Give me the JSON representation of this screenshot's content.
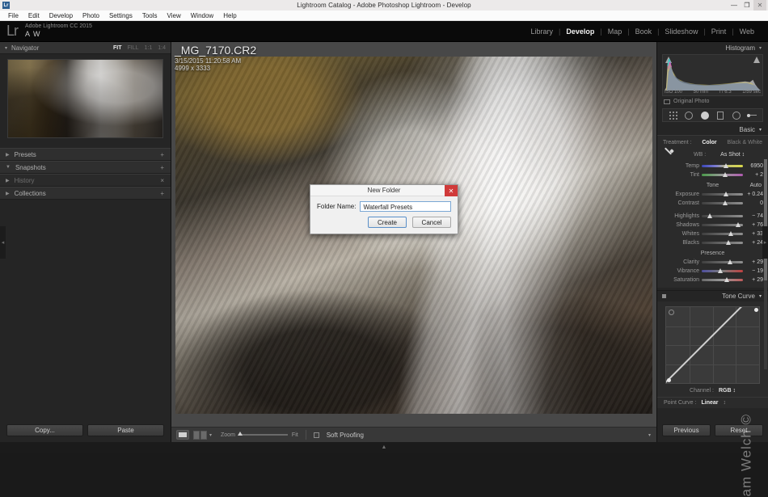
{
  "window": {
    "title": "Lightroom Catalog - Adobe Photoshop Lightroom - Develop",
    "minimize": "—",
    "maximize": "❐",
    "close": "✕",
    "app_icon_text": "Lr"
  },
  "menubar": [
    "File",
    "Edit",
    "Develop",
    "Photo",
    "Settings",
    "Tools",
    "View",
    "Window",
    "Help"
  ],
  "identity": {
    "logo": "Lr",
    "line1": "Adobe Lightroom CC 2015",
    "line2": "A W"
  },
  "modules": [
    {
      "label": "Library",
      "active": false
    },
    {
      "label": "Develop",
      "active": true
    },
    {
      "label": "Map",
      "active": false
    },
    {
      "label": "Book",
      "active": false
    },
    {
      "label": "Slideshow",
      "active": false
    },
    {
      "label": "Print",
      "active": false
    },
    {
      "label": "Web",
      "active": false
    }
  ],
  "left_panel": {
    "navigator": {
      "title": "Navigator",
      "zoom_levels": [
        {
          "label": "FIT",
          "active": true
        },
        {
          "label": "FILL",
          "active": false
        },
        {
          "label": "1:1",
          "active": false
        },
        {
          "label": "1:4",
          "active": false
        }
      ],
      "caret": "▾"
    },
    "sections": [
      {
        "label": "Presets",
        "expanded": false,
        "action": "+"
      },
      {
        "label": "Snapshots",
        "expanded": true,
        "action": "+"
      },
      {
        "label": "History",
        "expanded": false,
        "action": "×"
      },
      {
        "label": "Collections",
        "expanded": false,
        "action": "+"
      }
    ],
    "copy_button": "Copy...",
    "paste_button": "Paste"
  },
  "photo": {
    "filename": "_MG_7170.CR2",
    "date": "3/15/2015 11:20:58 AM",
    "dimensions": "4999 x 3333"
  },
  "toolbar": {
    "zoom_label": "Zoom",
    "zoom_value": "Fit",
    "soft_proofing": "Soft Proofing",
    "caret": "▾"
  },
  "right_panel": {
    "histogram": {
      "title": "Histogram",
      "caret": "▾",
      "iso": "ISO 100",
      "focal": "50 mm",
      "aperture": "f / 6.3",
      "shutter": "1/59 sec",
      "original_photo": "Original Photo"
    },
    "basic": {
      "title": "Basic",
      "caret": "▾",
      "treatment_label": "Treatment :",
      "treatment_color": "Color",
      "treatment_bw": "Black & White",
      "wb_label": "WB :",
      "wb_value": "As Shot ↕",
      "white_balance": [
        {
          "label": "Temp",
          "value": "6950",
          "pos": 52,
          "track": "temp"
        },
        {
          "label": "Tint",
          "value": "+ 2",
          "pos": 50,
          "track": "tint"
        }
      ],
      "tone_title": "Tone",
      "auto_label": "Auto",
      "tone": [
        {
          "label": "Exposure",
          "value": "+ 0.24",
          "pos": 52,
          "track": "gray"
        },
        {
          "label": "Contrast",
          "value": "0",
          "pos": 50,
          "track": "gray"
        },
        {
          "label": "Highlights",
          "value": "− 74",
          "pos": 14,
          "track": "gray"
        },
        {
          "label": "Shadows",
          "value": "+ 76",
          "pos": 82,
          "track": "gray"
        },
        {
          "label": "Whites",
          "value": "+ 33",
          "pos": 64,
          "track": "gray"
        },
        {
          "label": "Blacks",
          "value": "+ 24",
          "pos": 59,
          "track": "gray"
        }
      ],
      "presence_title": "Presence",
      "presence": [
        {
          "label": "Clarity",
          "value": "+ 29",
          "pos": 62,
          "track": "gray"
        },
        {
          "label": "Vibrance",
          "value": "− 19",
          "pos": 40,
          "track": "vib"
        },
        {
          "label": "Saturation",
          "value": "+ 29",
          "pos": 55,
          "track": "sat"
        }
      ]
    },
    "tone_curve": {
      "title": "Tone Curve",
      "caret": "▾",
      "channel_label": "Channel :",
      "channel_value": "RGB ↕",
      "point_curve_label": "Point Curve :",
      "point_curve_value": "Linear",
      "point_curve_caret": "↕"
    },
    "previous_button": "Previous",
    "reset_button": "Reset"
  },
  "dialog": {
    "title": "New Folder",
    "close": "✕",
    "field_label": "Folder Name:",
    "field_value": "Waterfall Presets",
    "create_button": "Create",
    "cancel_button": "Cancel"
  },
  "watermark": "am Welch ©",
  "colors": {
    "accent_blue": "#7aa7d4",
    "close_red": "#d03a3a",
    "panel_bg": "#252525"
  }
}
